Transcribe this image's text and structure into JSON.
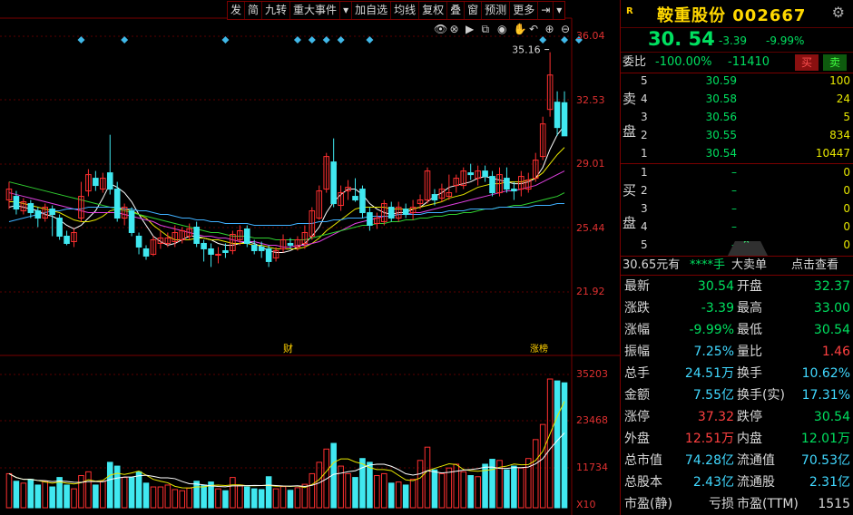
{
  "toolbar": {
    "items": [
      "发",
      "简",
      "九转",
      "重大事件",
      "▾",
      "加自选",
      "均线",
      "复权",
      "叠",
      "窗",
      "预测",
      "更多",
      "⇥",
      "▾"
    ]
  },
  "price_axis": [
    "36.04",
    "32.53",
    "29.01",
    "25.44",
    "21.92"
  ],
  "volume_axis": [
    "35203",
    "23468",
    "11734",
    "X10"
  ],
  "chart_icons": [
    "eye-icon",
    "x-circle-icon",
    "play-icon",
    "copy-icon",
    "camera-icon",
    "hand-icon",
    "undo-icon",
    "zoom-in-icon",
    "zoom-out-icon"
  ],
  "annotations": {
    "high_label": "35.16",
    "event_cai": "财",
    "event_zhangbang": "涨榜"
  },
  "chart_data": {
    "type": "candlestick",
    "price_range": [
      21.92,
      36.04
    ],
    "volume_max": 35203,
    "candles": [
      {
        "o": 27.0,
        "c": 27.6,
        "h": 28.0,
        "l": 26.5,
        "v": 9000
      },
      {
        "o": 27.2,
        "c": 26.5,
        "h": 27.5,
        "l": 26.2,
        "v": 7000
      },
      {
        "o": 26.4,
        "c": 26.9,
        "h": 27.1,
        "l": 26.2,
        "v": 6500
      },
      {
        "o": 26.8,
        "c": 26.3,
        "h": 27.0,
        "l": 26.0,
        "v": 7500
      },
      {
        "o": 26.4,
        "c": 26.0,
        "h": 26.6,
        "l": 25.5,
        "v": 6000
      },
      {
        "o": 26.0,
        "c": 26.6,
        "h": 26.8,
        "l": 25.8,
        "v": 7000
      },
      {
        "o": 26.5,
        "c": 26.2,
        "h": 26.7,
        "l": 25.0,
        "v": 5500
      },
      {
        "o": 26.0,
        "c": 25.0,
        "h": 26.2,
        "l": 24.8,
        "v": 8000
      },
      {
        "o": 25.0,
        "c": 24.6,
        "h": 25.3,
        "l": 24.5,
        "v": 6000
      },
      {
        "o": 24.7,
        "c": 25.2,
        "h": 25.4,
        "l": 24.4,
        "v": 5000
      },
      {
        "o": 26.0,
        "c": 27.2,
        "h": 28.0,
        "l": 25.8,
        "v": 8500
      },
      {
        "o": 27.5,
        "c": 28.4,
        "h": 28.7,
        "l": 27.2,
        "v": 9500
      },
      {
        "o": 28.2,
        "c": 27.8,
        "h": 28.6,
        "l": 27.5,
        "v": 6000
      },
      {
        "o": 27.6,
        "c": 28.2,
        "h": 28.5,
        "l": 27.4,
        "v": 7000
      },
      {
        "o": 28.5,
        "c": 27.6,
        "h": 30.6,
        "l": 27.3,
        "v": 12000
      },
      {
        "o": 27.6,
        "c": 26.0,
        "h": 28.0,
        "l": 25.8,
        "v": 11000
      },
      {
        "o": 26.0,
        "c": 26.6,
        "h": 26.8,
        "l": 25.6,
        "v": 8000
      },
      {
        "o": 26.4,
        "c": 25.2,
        "h": 26.6,
        "l": 25.0,
        "v": 8000
      },
      {
        "o": 25.0,
        "c": 24.4,
        "h": 25.2,
        "l": 24.0,
        "v": 9500
      },
      {
        "o": 24.3,
        "c": 23.9,
        "h": 24.5,
        "l": 23.7,
        "v": 6500
      },
      {
        "o": 24.0,
        "c": 24.8,
        "h": 25.0,
        "l": 23.9,
        "v": 5500
      },
      {
        "o": 24.6,
        "c": 24.9,
        "h": 25.3,
        "l": 24.3,
        "v": 5500
      },
      {
        "o": 24.6,
        "c": 24.9,
        "h": 25.2,
        "l": 24.4,
        "v": 6000
      },
      {
        "o": 24.7,
        "c": 25.2,
        "h": 25.6,
        "l": 24.4,
        "v": 4800
      },
      {
        "o": 24.8,
        "c": 25.3,
        "h": 25.5,
        "l": 24.6,
        "v": 4500
      },
      {
        "o": 25.0,
        "c": 25.4,
        "h": 25.7,
        "l": 24.8,
        "v": 5200
      },
      {
        "o": 25.5,
        "c": 24.6,
        "h": 25.8,
        "l": 24.4,
        "v": 7000
      },
      {
        "o": 24.6,
        "c": 24.3,
        "h": 24.8,
        "l": 23.6,
        "v": 6000
      },
      {
        "o": 24.3,
        "c": 24.0,
        "h": 24.6,
        "l": 23.3,
        "v": 6800
      },
      {
        "o": 24.0,
        "c": 24.0,
        "h": 24.4,
        "l": 23.5,
        "v": 5000
      },
      {
        "o": 24.2,
        "c": 24.1,
        "h": 24.6,
        "l": 23.8,
        "v": 4500
      },
      {
        "o": 24.2,
        "c": 25.1,
        "h": 25.3,
        "l": 24.0,
        "v": 8000
      },
      {
        "o": 24.8,
        "c": 25.3,
        "h": 25.6,
        "l": 24.5,
        "v": 6000
      },
      {
        "o": 25.4,
        "c": 24.6,
        "h": 25.6,
        "l": 24.4,
        "v": 5500
      },
      {
        "o": 24.5,
        "c": 24.2,
        "h": 24.8,
        "l": 24.0,
        "v": 5000
      },
      {
        "o": 24.4,
        "c": 24.2,
        "h": 24.7,
        "l": 23.8,
        "v": 4800
      },
      {
        "o": 24.3,
        "c": 23.6,
        "h": 24.5,
        "l": 23.3,
        "v": 8200
      },
      {
        "o": 23.8,
        "c": 24.2,
        "h": 24.4,
        "l": 23.6,
        "v": 5000
      },
      {
        "o": 24.3,
        "c": 24.8,
        "h": 25.1,
        "l": 24.1,
        "v": 5600
      },
      {
        "o": 24.6,
        "c": 24.5,
        "h": 24.9,
        "l": 24.3,
        "v": 4600
      },
      {
        "o": 24.4,
        "c": 24.8,
        "h": 25.0,
        "l": 24.2,
        "v": 5300
      },
      {
        "o": 24.6,
        "c": 25.2,
        "h": 25.6,
        "l": 24.3,
        "v": 6200
      },
      {
        "o": 25.0,
        "c": 26.4,
        "h": 26.6,
        "l": 24.8,
        "v": 9000
      },
      {
        "o": 26.0,
        "c": 27.5,
        "h": 27.8,
        "l": 25.9,
        "v": 12000
      },
      {
        "o": 27.6,
        "c": 29.4,
        "h": 29.6,
        "l": 27.4,
        "v": 15500
      },
      {
        "o": 29.1,
        "c": 26.8,
        "h": 30.4,
        "l": 26.6,
        "v": 17000
      },
      {
        "o": 26.7,
        "c": 27.4,
        "h": 27.8,
        "l": 26.4,
        "v": 11000
      },
      {
        "o": 27.5,
        "c": 27.7,
        "h": 28.1,
        "l": 27.0,
        "v": 9000
      },
      {
        "o": 27.2,
        "c": 27.0,
        "h": 28.2,
        "l": 26.9,
        "v": 8000
      },
      {
        "o": 27.6,
        "c": 26.3,
        "h": 27.8,
        "l": 26.0,
        "v": 13000
      },
      {
        "o": 26.3,
        "c": 25.6,
        "h": 26.6,
        "l": 25.3,
        "v": 12000
      },
      {
        "o": 25.7,
        "c": 26.0,
        "h": 26.3,
        "l": 25.4,
        "v": 8500
      },
      {
        "o": 25.8,
        "c": 26.8,
        "h": 27.0,
        "l": 25.6,
        "v": 9000
      },
      {
        "o": 26.6,
        "c": 26.0,
        "h": 26.9,
        "l": 25.8,
        "v": 6500
      },
      {
        "o": 26.0,
        "c": 26.6,
        "h": 26.9,
        "l": 25.8,
        "v": 6800
      },
      {
        "o": 26.5,
        "c": 26.2,
        "h": 26.8,
        "l": 26.0,
        "v": 6000
      },
      {
        "o": 26.3,
        "c": 26.6,
        "h": 27.0,
        "l": 25.9,
        "v": 7500
      },
      {
        "o": 26.8,
        "c": 27.0,
        "h": 27.3,
        "l": 26.5,
        "v": 12500
      },
      {
        "o": 27.0,
        "c": 28.6,
        "h": 28.8,
        "l": 26.8,
        "v": 16000
      },
      {
        "o": 27.3,
        "c": 27.0,
        "h": 27.6,
        "l": 26.7,
        "v": 10000
      },
      {
        "o": 27.1,
        "c": 27.6,
        "h": 27.9,
        "l": 26.9,
        "v": 9000
      },
      {
        "o": 27.2,
        "c": 27.4,
        "h": 28.4,
        "l": 27.0,
        "v": 10500
      },
      {
        "o": 27.8,
        "c": 28.2,
        "h": 28.4,
        "l": 27.4,
        "v": 11500
      },
      {
        "o": 27.8,
        "c": 28.6,
        "h": 28.8,
        "l": 27.6,
        "v": 9500
      },
      {
        "o": 28.5,
        "c": 28.4,
        "h": 29.0,
        "l": 28.1,
        "v": 8500
      },
      {
        "o": 28.2,
        "c": 28.6,
        "h": 28.9,
        "l": 27.8,
        "v": 8200
      },
      {
        "o": 28.6,
        "c": 28.3,
        "h": 28.9,
        "l": 28.0,
        "v": 11500
      },
      {
        "o": 28.3,
        "c": 27.4,
        "h": 28.6,
        "l": 27.2,
        "v": 12800
      },
      {
        "o": 27.4,
        "c": 28.4,
        "h": 28.8,
        "l": 27.2,
        "v": 12500
      },
      {
        "o": 28.2,
        "c": 27.6,
        "h": 28.8,
        "l": 27.4,
        "v": 10000
      },
      {
        "o": 27.6,
        "c": 27.5,
        "h": 28.0,
        "l": 27.0,
        "v": 11000
      },
      {
        "o": 27.6,
        "c": 28.3,
        "h": 28.6,
        "l": 27.2,
        "v": 10500
      },
      {
        "o": 27.6,
        "c": 28.1,
        "h": 28.5,
        "l": 27.4,
        "v": 13000
      },
      {
        "o": 28.2,
        "c": 29.2,
        "h": 29.6,
        "l": 28.0,
        "v": 18000
      },
      {
        "o": 29.4,
        "c": 31.2,
        "h": 31.6,
        "l": 29.2,
        "v": 22000
      },
      {
        "o": 32.0,
        "c": 33.9,
        "h": 35.16,
        "l": 31.6,
        "v": 34000
      },
      {
        "o": 32.4,
        "c": 31.0,
        "h": 33.0,
        "l": 30.54,
        "v": 33500
      },
      {
        "o": 32.37,
        "c": 30.54,
        "h": 33.0,
        "l": 30.54,
        "v": 33000
      }
    ],
    "ma_series": [
      {
        "color": "#ffffff",
        "values": [
          26.6,
          26.7,
          26.6,
          26.5,
          26.4,
          26.2,
          26.1,
          25.9,
          25.6,
          25.4,
          25.6,
          26.0,
          26.4,
          27.1,
          27.9,
          27.7,
          27.4,
          26.9,
          26.2,
          25.6,
          25.0,
          24.7,
          24.5,
          24.6,
          24.8,
          25.0,
          25.0,
          24.9,
          24.8,
          24.6,
          24.5,
          24.5,
          24.6,
          24.7,
          24.6,
          24.4,
          24.2,
          24.1,
          24.1,
          24.2,
          24.4,
          24.6,
          25.0,
          25.5,
          26.3,
          26.9,
          27.3,
          27.6,
          27.6,
          27.3,
          26.8,
          26.5,
          26.3,
          26.2,
          26.3,
          26.3,
          26.5,
          26.6,
          26.9,
          27.2,
          27.4,
          27.7,
          27.8,
          27.9,
          28.0,
          28.2,
          28.3,
          28.2,
          28.1,
          28.0,
          27.9,
          27.9,
          28.0,
          28.2,
          28.8,
          29.8,
          30.6,
          31.1
        ]
      },
      {
        "color": "#e8e800",
        "values": [
          26.9,
          26.9,
          26.8,
          26.7,
          26.6,
          26.5,
          26.4,
          26.3,
          26.1,
          25.9,
          25.8,
          25.8,
          25.9,
          26.1,
          26.4,
          26.5,
          26.5,
          26.4,
          26.2,
          26.0,
          25.6,
          25.3,
          25.0,
          24.8,
          24.8,
          24.8,
          24.9,
          24.9,
          24.8,
          24.8,
          24.7,
          24.6,
          24.6,
          24.6,
          24.5,
          24.5,
          24.4,
          24.3,
          24.3,
          24.3,
          24.3,
          24.4,
          24.6,
          24.9,
          25.3,
          25.6,
          25.9,
          26.2,
          26.5,
          26.6,
          26.6,
          26.6,
          26.6,
          26.5,
          26.5,
          26.5,
          26.5,
          26.6,
          26.7,
          26.8,
          26.9,
          27.1,
          27.2,
          27.3,
          27.5,
          27.7,
          27.8,
          27.9,
          27.9,
          28.0,
          28.0,
          28.0,
          28.1,
          28.2,
          28.5,
          29.0,
          29.5,
          29.9
        ]
      },
      {
        "color": "#e040e0",
        "values": [
          27.4,
          27.3,
          27.2,
          27.1,
          27.0,
          26.9,
          26.8,
          26.7,
          26.6,
          26.5,
          26.4,
          26.3,
          26.3,
          26.3,
          26.3,
          26.3,
          26.2,
          26.1,
          26.0,
          25.9,
          25.8,
          25.6,
          25.5,
          25.4,
          25.3,
          25.2,
          25.1,
          25.0,
          25.0,
          24.9,
          24.9,
          24.8,
          24.7,
          24.7,
          24.7,
          24.6,
          24.5,
          24.5,
          24.4,
          24.4,
          24.5,
          24.5,
          24.6,
          24.7,
          24.9,
          25.1,
          25.3,
          25.5,
          25.7,
          25.8,
          25.9,
          26.0,
          26.1,
          26.1,
          26.2,
          26.2,
          26.3,
          26.3,
          26.4,
          26.5,
          26.6,
          26.7,
          26.8,
          26.9,
          27.0,
          27.1,
          27.2,
          27.3,
          27.4,
          27.5,
          27.5,
          27.6,
          27.7,
          27.8,
          28.0,
          28.2,
          28.4,
          28.6
        ]
      },
      {
        "color": "#30d030",
        "values": [
          28.0,
          27.9,
          27.8,
          27.7,
          27.6,
          27.5,
          27.4,
          27.3,
          27.2,
          27.1,
          27.0,
          26.9,
          26.8,
          26.7,
          26.6,
          26.5,
          26.4,
          26.3,
          26.2,
          26.1,
          26.0,
          25.9,
          25.8,
          25.7,
          25.6,
          25.5,
          25.4,
          25.3,
          25.2,
          25.2,
          25.1,
          25.0,
          25.0,
          25.0,
          24.9,
          24.9,
          24.9,
          24.8,
          24.8,
          24.8,
          24.8,
          24.8,
          24.9,
          25.0,
          25.1,
          25.2,
          25.3,
          25.4,
          25.5,
          25.6,
          25.6,
          25.7,
          25.7,
          25.8,
          25.8,
          25.9,
          25.9,
          26.0,
          26.0,
          26.1,
          26.1,
          26.2,
          26.2,
          26.3,
          26.3,
          26.4,
          26.5,
          26.5,
          26.6,
          26.6,
          26.7,
          26.7,
          26.8,
          26.9,
          27.0,
          27.1,
          27.2,
          27.4
        ]
      },
      {
        "color": "#40b0ff",
        "values": [
          25.8,
          25.9,
          26.0,
          26.1,
          26.2,
          26.3,
          26.4,
          26.4,
          26.5,
          26.5,
          26.5,
          26.6,
          26.6,
          26.6,
          26.6,
          26.6,
          26.5,
          26.5,
          26.4,
          26.4,
          26.3,
          26.2,
          26.2,
          26.1,
          26.0,
          26.0,
          25.9,
          25.9,
          25.8,
          25.8,
          25.7,
          25.7,
          25.7,
          25.7,
          25.6,
          25.6,
          25.6,
          25.6,
          25.6,
          25.6,
          25.7,
          25.7,
          25.7,
          25.8,
          25.8,
          25.9,
          25.9,
          26.0,
          26.0,
          26.0,
          26.1,
          26.1,
          26.1,
          26.1,
          26.2,
          26.2,
          26.2,
          26.2,
          26.3,
          26.3,
          26.3,
          26.4,
          26.4,
          26.4,
          26.5,
          26.5,
          26.5,
          26.5,
          26.6,
          26.6,
          26.6,
          26.6,
          26.6,
          26.7,
          26.7,
          26.7,
          26.8,
          26.8
        ]
      }
    ],
    "vol_ma_series": [
      {
        "color": "#e8e800"
      },
      {
        "color": "#ffffff"
      }
    ],
    "event_markers_at": [
      10,
      16,
      30,
      40,
      42,
      44,
      46,
      50,
      74,
      77,
      79
    ],
    "colors": {
      "up": "#ff3030",
      "down": "#40e8f0",
      "grid": "#5a0000"
    }
  },
  "panel": {
    "badge": "R",
    "stock_name": "鞍重股份 002667",
    "last_price": "30. 54",
    "change": "-3.39",
    "change_pct": "-9.99%",
    "weibi_label": "委比",
    "weibi_value": "-100.00%",
    "weicha_value": "-11410",
    "buy_label": "买",
    "sell_label": "卖",
    "sell_side_label": [
      "卖",
      "盘"
    ],
    "buy_side_label": [
      "买",
      "盘"
    ],
    "asks": [
      {
        "lvl": "5",
        "px": "30.59",
        "qty": "100"
      },
      {
        "lvl": "4",
        "px": "30.58",
        "qty": "24"
      },
      {
        "lvl": "3",
        "px": "30.56",
        "qty": "5"
      },
      {
        "lvl": "2",
        "px": "30.55",
        "qty": "834"
      },
      {
        "lvl": "1",
        "px": "30.54",
        "qty": "10447"
      }
    ],
    "bids": [
      {
        "lvl": "1",
        "px": "–",
        "qty": "0"
      },
      {
        "lvl": "2",
        "px": "–",
        "qty": "0"
      },
      {
        "lvl": "3",
        "px": "–",
        "qty": "0"
      },
      {
        "lvl": "4",
        "px": "–",
        "qty": "0"
      },
      {
        "lvl": "5",
        "px": "–",
        "qty": "0"
      }
    ],
    "trade_info": {
      "price": "30.65元有",
      "hands": "****手",
      "big": "大卖单",
      "view": "点击查看"
    },
    "stats": [
      {
        "k1": "最新",
        "v1": "30.54",
        "c1": "g",
        "k2": "开盘",
        "v2": "32.37",
        "c2": "g"
      },
      {
        "k1": "涨跌",
        "v1": "-3.39",
        "c1": "g",
        "k2": "最高",
        "v2": "33.00",
        "c2": "g"
      },
      {
        "k1": "涨幅",
        "v1": "-9.99%",
        "c1": "g",
        "k2": "最低",
        "v2": "30.54",
        "c2": "g"
      },
      {
        "k1": "振幅",
        "v1": "7.25%",
        "c1": "c",
        "k2": "量比",
        "v2": "1.46",
        "c2": "r"
      },
      {
        "k1": "总手",
        "v1": "24.51万",
        "c1": "c",
        "k2": "换手",
        "v2": "10.62%",
        "c2": "c"
      },
      {
        "k1": "金额",
        "v1": "7.55亿",
        "c1": "c",
        "k2": "换手(实)",
        "v2": "17.31%",
        "c2": "c"
      },
      {
        "k1": "涨停",
        "v1": "37.32",
        "c1": "r",
        "k2": "跌停",
        "v2": "30.54",
        "c2": "g"
      },
      {
        "k1": "外盘",
        "v1": "12.51万",
        "c1": "r",
        "k2": "内盘",
        "v2": "12.01万",
        "c2": "g"
      },
      {
        "k1": "总市值",
        "v1": "74.28亿",
        "c1": "c",
        "k2": "流通值",
        "v2": "70.53亿",
        "c2": "c"
      },
      {
        "k1": "总股本",
        "v1": "2.43亿",
        "c1": "c",
        "k2": "流通股",
        "v2": "2.31亿",
        "c2": "c"
      },
      {
        "k1": "市盈(静)",
        "v1": "亏损",
        "c1": "w",
        "k2": "市盈(TTM)",
        "v2": "1515",
        "c2": "w"
      }
    ]
  }
}
